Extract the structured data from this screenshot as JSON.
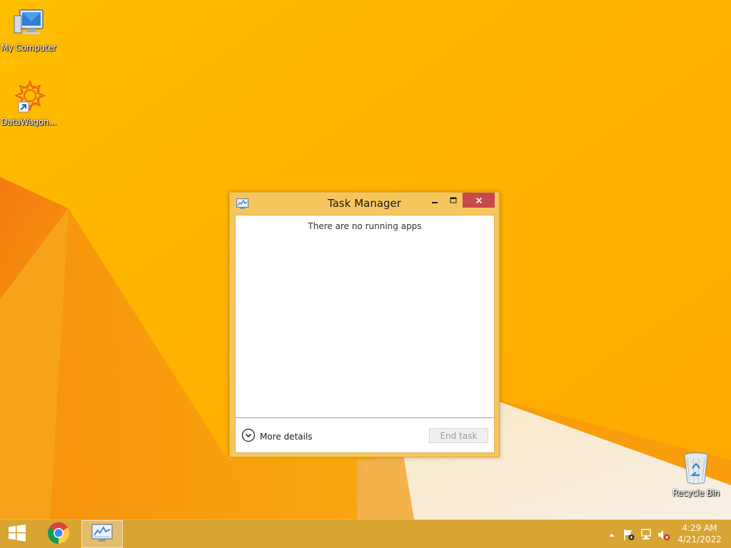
{
  "desktop": {
    "icons": [
      {
        "label": "My Computer",
        "icon": "computer-icon"
      },
      {
        "label": "DataWagon...",
        "icon": "datawagon-icon"
      },
      {
        "label": "Recycle Bin",
        "icon": "recycle-bin-icon"
      }
    ]
  },
  "window": {
    "title": "Task Manager",
    "icon": "task-manager-icon",
    "empty_message": "There are no running apps",
    "more_details_label": "More details",
    "end_task_label": "End task",
    "controls": {
      "minimize": "minimize-icon",
      "maximize": "maximize-icon",
      "close": "close-icon"
    }
  },
  "taskbar": {
    "start": "windows-logo-icon",
    "pinned": [
      {
        "name": "Google Chrome",
        "icon": "chrome-icon"
      },
      {
        "name": "Task Manager",
        "icon": "task-manager-icon",
        "active": true
      }
    ],
    "tray": {
      "icons": [
        "show-hidden-icons-chevron",
        "action-center-flag-icon",
        "network-icon",
        "volume-muted-icon"
      ],
      "time": "4:29 AM",
      "date": "4/21/2022"
    }
  },
  "colors": {
    "wallpaper": "#ffb300",
    "taskbar": "#d8a432",
    "window_frame": "#f6c65e",
    "close_button": "#c7494a"
  }
}
